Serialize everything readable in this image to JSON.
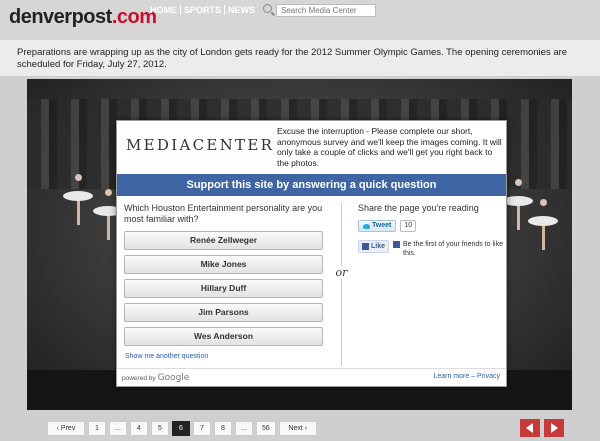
{
  "header": {
    "logo_name": "denverpost",
    "logo_suffix": ".com",
    "nav": [
      "HOME",
      "SPORTS",
      "NEWS"
    ],
    "search_placeholder": "Search Media Center"
  },
  "caption": "Preparations are wrapping up as the city of London gets ready for the 2012 Summer Olympic Games. The opening ceremonies are scheduled for Friday, July 27, 2012.",
  "survey": {
    "logo": "MEDIACENTER",
    "message": "Excuse the interruption - Please complete our short, anonymous survey and we'll keep the images coming. It will only take a couple of clicks and we'll get you right back to the photos.",
    "banner": "Support this site by answering a quick question",
    "question": "Which Houston Entertainment personality are you most familiar with?",
    "answers": [
      "Renée Zellweger",
      "Mike Jones",
      "Hillary Duff",
      "Jim Parsons",
      "Wes Anderson"
    ],
    "another_link": "Show me another question",
    "or_label": "or",
    "share_label": "Share the page you're reading",
    "tweet_label": "Tweet",
    "tweet_count": "10",
    "like_label": "Like",
    "like_text": "Be the first of your friends to like this.",
    "powered_by": "powered by",
    "google": "Google",
    "learn_more": "Learn more",
    "privacy": "Privacy",
    "link_sep": " – "
  },
  "pagination": {
    "prev": "‹ Prev",
    "next": "Next ›",
    "pages": [
      "1",
      "...",
      "4",
      "5",
      "6",
      "7",
      "8",
      "...",
      "56"
    ],
    "active": "6"
  },
  "colors": {
    "banner": "#3f65a4",
    "logo_dot": "#c8102e",
    "arrow": "#c73a3a"
  }
}
